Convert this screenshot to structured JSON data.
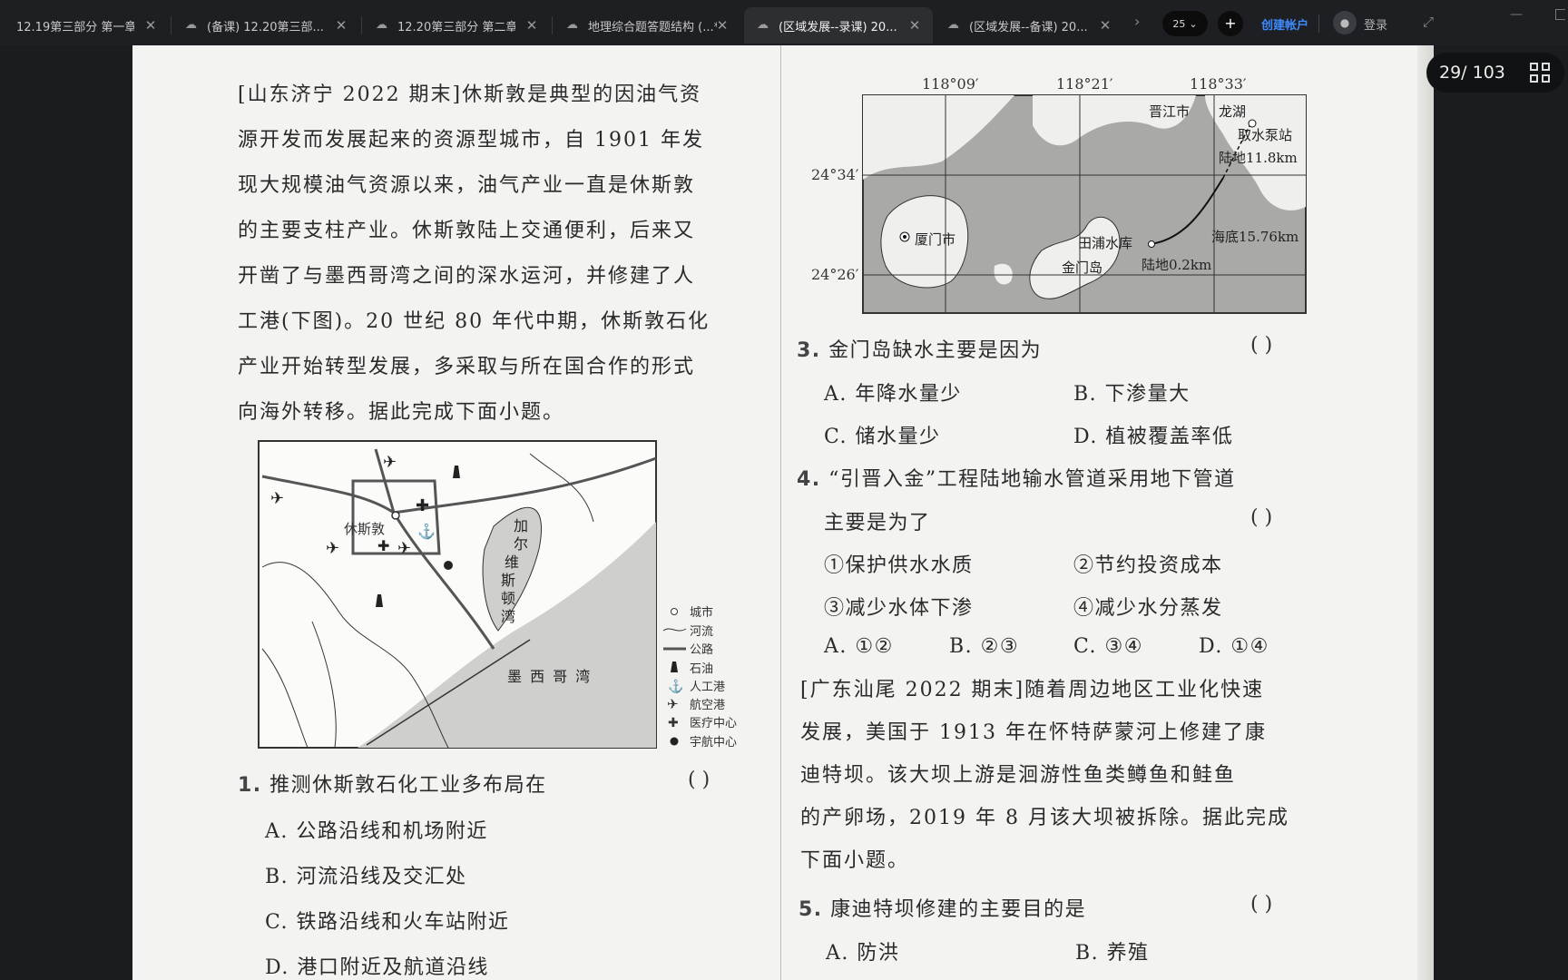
{
  "tabs": [
    {
      "label": "12.19第三部分 第一章..."
    },
    {
      "label": "(备课) 12.20第三部..."
    },
    {
      "label": "12.20第三部分 第二章..."
    },
    {
      "label": "地理综合题答题结构 (...*"
    },
    {
      "label": "(区域发展--录课) 20..."
    },
    {
      "label": "(区域发展--备课) 20..."
    }
  ],
  "toolbar": {
    "zoom_value": "25",
    "create_account": "创建帐户",
    "login": "登录"
  },
  "viewer": {
    "page_counter": "29/ 103"
  },
  "doc": {
    "intro_lines": [
      "[山东济宁 2022 期末]休斯敦是典型的因油气资",
      "源开发而发展起来的资源型城市，自 1901 年发",
      "现大规模油气资源以来，油气产业一直是休斯敦",
      "的主要支柱产业。休斯敦陆上交通便利，后来又",
      "开凿了与墨西哥湾之间的深水运河，并修建了人",
      "工港(下图)。20 世纪 80 年代中期，休斯敦石化",
      "产业开始转型发展，多采取与所在国合作的形式",
      "向海外转移。据此完成下面小题。"
    ],
    "map1": {
      "city_label": "休斯敦",
      "bay_label_chars": [
        "加",
        "尔",
        "维",
        "斯",
        "顿",
        "湾"
      ],
      "gulf_label": "墨 西 哥 湾",
      "legend": [
        "城市",
        "河流",
        "公路",
        "石油",
        "人工港",
        "航空港",
        "医疗中心",
        "宇航中心"
      ]
    },
    "map2": {
      "lon_labels": [
        "118°09′",
        "118°21′",
        "118°33′"
      ],
      "lat_labels": [
        "24°34′",
        "24°26′"
      ],
      "places": [
        "晋江市",
        "龙湖",
        "取水泵站",
        "陆地11.8km",
        "厦门市",
        "田浦水库",
        "海底15.76km",
        "金门岛",
        "陆地0.2km"
      ]
    },
    "q1": {
      "num": "1.",
      "stem": "推测休斯敦石化工业多布局在",
      "paren": "(      )",
      "options": [
        "A. 公路沿线和机场附近",
        "B. 河流沿线及交汇处",
        "C. 铁路沿线和火车站附近",
        "D. 港口附近及航道沿线"
      ]
    },
    "q3": {
      "num": "3.",
      "stem": "金门岛缺水主要是因为",
      "paren": "(      )",
      "options": [
        "A. 年降水量少",
        "B. 下渗量大",
        "C. 储水量少",
        "D. 植被覆盖率低"
      ]
    },
    "q4": {
      "num": "4.",
      "stem_line1": "“引晋入金”工程陆地输水管道采用地下管道",
      "stem_line2": "主要是为了",
      "paren": "(      )",
      "items": [
        "①保护供水水质",
        "②节约投资成本",
        "③减少水体下渗",
        "④减少水分蒸发"
      ],
      "options": [
        "A. ①②",
        "B. ②③",
        "C. ③④",
        "D. ①④"
      ]
    },
    "intro2_lines": [
      "[广东汕尾 2022 期末]随着周边地区工业化快速",
      "发展，美国于 1913 年在怀特萨蒙河上修建了康",
      "迪特坝。该大坝上游是洄游性鱼类鳟鱼和鲑鱼",
      "的产卵场，2019 年 8 月该大坝被拆除。据此完成",
      "下面小题。"
    ],
    "q5": {
      "num": "5.",
      "stem": "康迪特坝修建的主要目的是",
      "paren": "(      )",
      "options": [
        "A. 防洪",
        "B. 养殖"
      ]
    }
  }
}
